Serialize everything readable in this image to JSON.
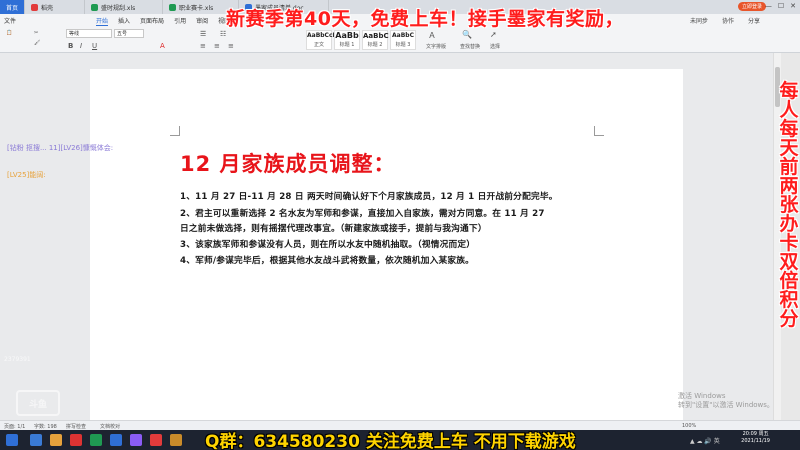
{
  "tabs": [
    {
      "label": "首页",
      "color": "#2f6fd6"
    },
    {
      "label": "稻壳",
      "color": "#e23b3b"
    },
    {
      "label": "盛时规刮.xls",
      "color": "#1f9a52"
    },
    {
      "label": "职业赛卡.xls",
      "color": "#1f9a52"
    },
    {
      "label": "墨家成员清单.doc",
      "color": "#2f6fd6"
    }
  ],
  "titlebar": {
    "login": "立即登录"
  },
  "menu": {
    "items": [
      "文件",
      "开始",
      "插入",
      "页面布局",
      "引用",
      "审阅",
      "视图",
      "章节",
      "开发工具",
      "会员专享",
      "搜索"
    ],
    "right": [
      "未同步",
      "协作",
      "分享"
    ]
  },
  "ribbon": {
    "font_name": "等线",
    "font_size": "五号",
    "styles": [
      {
        "preview": "AaBbCcDd",
        "label": "正文"
      },
      {
        "preview": "AaBb",
        "label": "标题 1"
      },
      {
        "preview": "AaBbC",
        "label": "标题 2"
      },
      {
        "preview": "AaBbC",
        "label": "标题 3"
      }
    ],
    "text_tools": "文字排版",
    "find_replace": "查找替换",
    "select": "选择"
  },
  "banners": {
    "top": "新赛季第40天，免费上车！接手墨家有奖励，",
    "right": "每人每天前两张办卡双倍积分",
    "bottom": "Q群：634580230 关注免费上车 不用下载游戏"
  },
  "chat": [
    {
      "text": "[钻粉 抠搜... 11][LV26]慷慨体会:",
      "color": "#8a7ad6"
    },
    {
      "text": "[LV25]能阔:",
      "color": "#e8a23a"
    }
  ],
  "document": {
    "title": "12 月家族成员调整：",
    "paragraphs": [
      "1、11 月 27 日-11 月 28 日  两天时间确认好下个月家族成员，12 月 1 日开战前分配完毕。",
      "2、君主可以重新选择 2 名水友为军师和参谋，直接加入自家族，需对方同意。在 11 月 27",
      "日之前未做选择，则有摇摆代理改事宜。（新建家族或接手，提前与我沟通下）",
      "3、该家族军师和参谋没有人员，则在所以水友中随机抽取。（视情况而定）",
      "4、军师/参谋完毕后，根据其他水友战斗武将数量，依次随机加入某家族。"
    ]
  },
  "watermark": {
    "line1": "激活 Windows",
    "line2": "转到\"设置\"以激活 Windows。"
  },
  "logo": "斗鱼",
  "streamer_id": "2379391",
  "status": {
    "page": "页面: 1/1",
    "words": "字数: 198",
    "spell": "拼写检查",
    "proof": "文档校对",
    "zoom": "100%"
  },
  "taskbar": {
    "time": "20:09 周五",
    "date": "2021/11/19"
  }
}
